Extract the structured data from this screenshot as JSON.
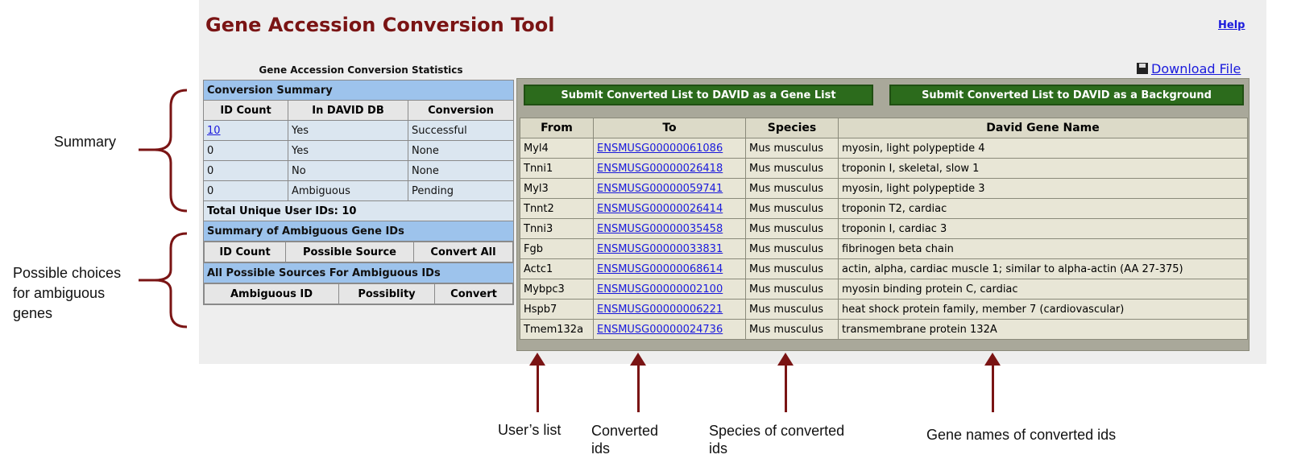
{
  "app_title": "Gene Accession Conversion Tool",
  "help_label": "Help",
  "stats_title": "Gene Accession Conversion Statistics",
  "download_label": "Download File",
  "conversion_summary": {
    "section_title": "Conversion Summary",
    "headers": [
      "ID Count",
      "In DAVID DB",
      "Conversion"
    ],
    "rows": [
      {
        "count": "10",
        "in_db": "Yes",
        "conversion": "Successful"
      },
      {
        "count": "0",
        "in_db": "Yes",
        "conversion": "None"
      },
      {
        "count": "0",
        "in_db": "No",
        "conversion": "None"
      },
      {
        "count": "0",
        "in_db": "Ambiguous",
        "conversion": "Pending"
      }
    ],
    "total": "Total Unique User IDs: 10"
  },
  "ambiguous_summary": {
    "section_title": "Summary of Ambiguous Gene IDs",
    "headers": [
      "ID Count",
      "Possible Source",
      "Convert All"
    ]
  },
  "ambiguous_sources": {
    "section_title": "All Possible Sources For Ambiguous IDs",
    "headers": [
      "Ambiguous ID",
      "Possiblity",
      "Convert"
    ]
  },
  "buttons": {
    "gene_list": "Submit Converted List to DAVID as a Gene List",
    "background": "Submit Converted List to DAVID as a Background"
  },
  "results": {
    "headers": [
      "From",
      "To",
      "Species",
      "David Gene Name"
    ],
    "rows": [
      {
        "from": "Myl4",
        "to": "ENSMUSG00000061086",
        "species": "Mus musculus",
        "name": "myosin, light polypeptide 4"
      },
      {
        "from": "Tnni1",
        "to": "ENSMUSG00000026418",
        "species": "Mus musculus",
        "name": "troponin I, skeletal, slow 1"
      },
      {
        "from": "Myl3",
        "to": "ENSMUSG00000059741",
        "species": "Mus musculus",
        "name": "myosin, light polypeptide 3"
      },
      {
        "from": "Tnnt2",
        "to": "ENSMUSG00000026414",
        "species": "Mus musculus",
        "name": "troponin T2, cardiac"
      },
      {
        "from": "Tnni3",
        "to": "ENSMUSG00000035458",
        "species": "Mus musculus",
        "name": "troponin I, cardiac 3"
      },
      {
        "from": "Fgb",
        "to": "ENSMUSG00000033831",
        "species": "Mus musculus",
        "name": "fibrinogen beta chain"
      },
      {
        "from": "Actc1",
        "to": "ENSMUSG00000068614",
        "species": "Mus musculus",
        "name": "actin, alpha, cardiac muscle 1; similar to alpha-actin (AA 27-375)"
      },
      {
        "from": "Mybpc3",
        "to": "ENSMUSG00000002100",
        "species": "Mus musculus",
        "name": "myosin binding protein C, cardiac"
      },
      {
        "from": "Hspb7",
        "to": "ENSMUSG00000006221",
        "species": "Mus musculus",
        "name": "heat shock protein family, member 7 (cardiovascular)"
      },
      {
        "from": "Tmem132a",
        "to": "ENSMUSG00000024736",
        "species": "Mus musculus",
        "name": "transmembrane protein 132A"
      }
    ]
  },
  "annotations": {
    "summary": "Summary",
    "ambiguous_line1": "Possible choices",
    "ambiguous_line2": "for ambiguous",
    "ambiguous_line3": "genes",
    "users_list": "User’s list",
    "converted_line1": "Converted",
    "converted_line2": "ids",
    "species_line1": "Species of converted",
    "species_line2": "ids",
    "gene_names": "Gene names of converted ids"
  },
  "colors": {
    "title": "#7a1414",
    "annotation": "#7a1414",
    "button": "#2c6b1c",
    "section_header": "#9dc3ec"
  }
}
